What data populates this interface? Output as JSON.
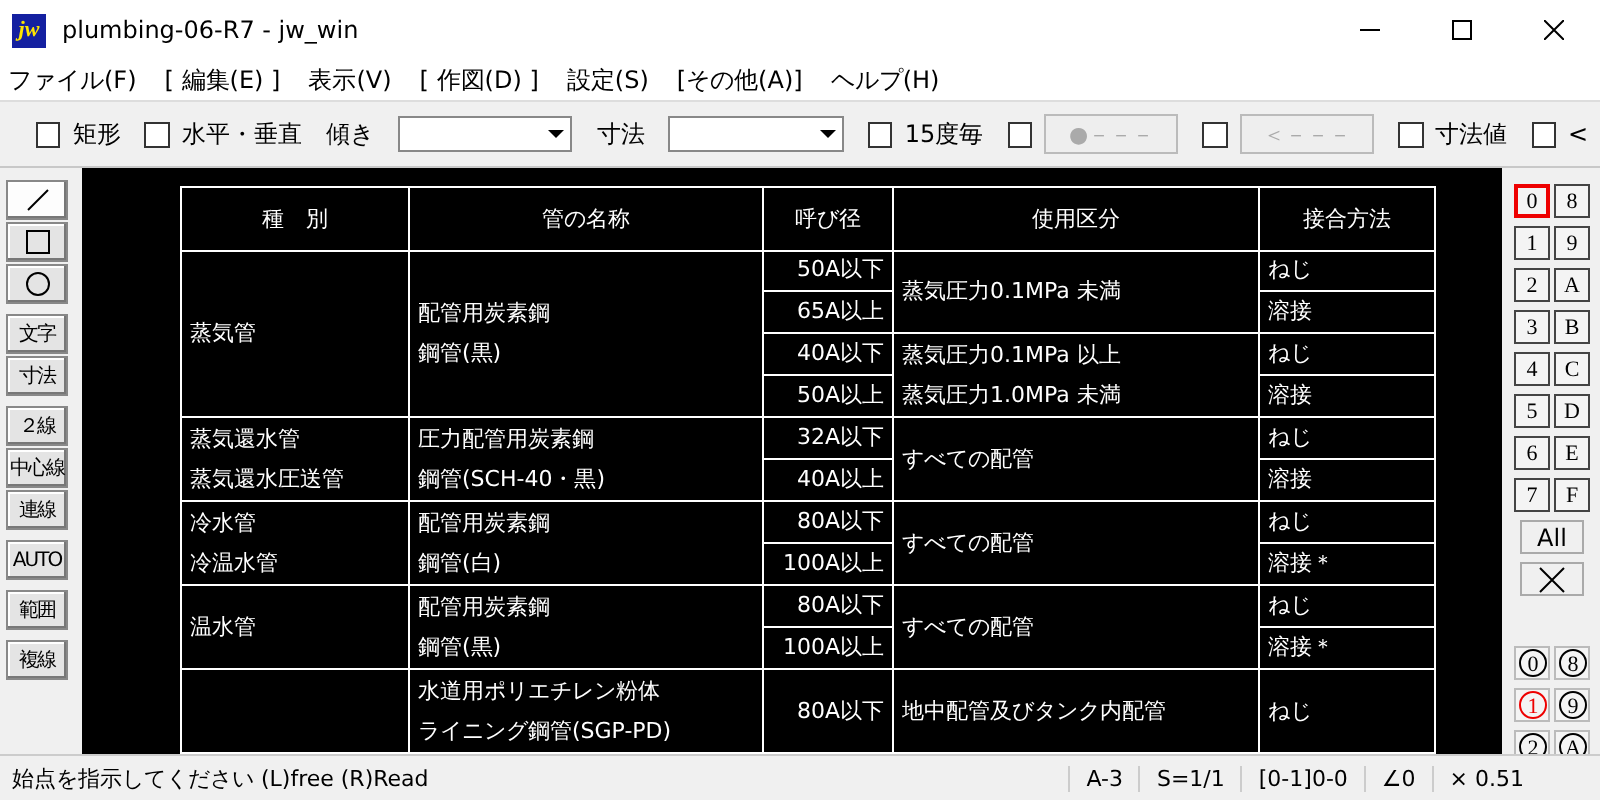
{
  "window": {
    "logo": "jw",
    "title": "plumbing-06-R7 - jw_win"
  },
  "menu": [
    "ファイル(F)",
    "[ 編集(E) ]",
    "表示(V)",
    "[ 作図(D) ]",
    "設定(S)",
    "[その他(A)]",
    "ヘルプ(H)"
  ],
  "toolbar": [
    {
      "kind": "check",
      "label": "矩形",
      "checked": false
    },
    {
      "kind": "check",
      "label": "水平・垂直",
      "checked": false
    },
    {
      "kind": "combo",
      "label": "傾き"
    },
    {
      "kind": "combo",
      "label": "寸法"
    },
    {
      "kind": "check",
      "label": "15度毎",
      "checked": false
    },
    {
      "kind": "checkbutton",
      "label": "●－－－",
      "checked": false,
      "disabled": true
    },
    {
      "kind": "checkbutton",
      "label": "＜－－－",
      "checked": false,
      "disabled": true
    },
    {
      "kind": "check",
      "label": "寸法値",
      "checked": false
    },
    {
      "kind": "check",
      "label": "<",
      "checked": false
    }
  ],
  "tools": [
    [
      {
        "kind": "line",
        "selected": true
      },
      {
        "kind": "rect",
        "selected": false
      },
      {
        "kind": "circle",
        "selected": false
      }
    ],
    [
      {
        "kind": "text",
        "label": "文字",
        "selected": false
      },
      {
        "kind": "text",
        "label": "寸法",
        "selected": false
      }
    ],
    [
      {
        "kind": "text",
        "label": "２線",
        "selected": false
      },
      {
        "kind": "text",
        "label": "中心線",
        "selected": false
      },
      {
        "kind": "text",
        "label": "連線",
        "selected": false
      }
    ],
    [
      {
        "kind": "text",
        "label": "AUTO",
        "selected": false
      }
    ],
    [
      {
        "kind": "text",
        "label": "範囲",
        "selected": false
      }
    ],
    [
      {
        "kind": "text",
        "label": "複線",
        "selected": false
      }
    ]
  ],
  "table": {
    "headers": [
      "種　別",
      "管の名称",
      "呼び径",
      "使用区分",
      "接合方法"
    ],
    "groups": [
      {
        "category": [
          "蒸気管"
        ],
        "pipe": [
          "配管用炭素鋼",
          "鋼管(黒)"
        ],
        "sizes": [
          "50A以下",
          "65A以上",
          "40A以下",
          "50A以上"
        ],
        "usage": [
          [
            "蒸気圧力0.1MPa 未満"
          ],
          [
            "蒸気圧力0.1MPa 以上",
            "蒸気圧力1.0MPa 未満"
          ]
        ],
        "joints": [
          "ねじ",
          "溶接",
          "ねじ",
          "溶接"
        ]
      },
      {
        "category": [
          "蒸気還水管",
          "蒸気還水圧送管"
        ],
        "pipe": [
          "圧力配管用炭素鋼",
          "鋼管(SCH-40・黒)"
        ],
        "sizes": [
          "32A以下",
          "40A以上"
        ],
        "usage": [
          [
            "すべての配管"
          ]
        ],
        "joints": [
          "ねじ",
          "溶接"
        ]
      },
      {
        "category": [
          "冷水管",
          "冷温水管"
        ],
        "pipe": [
          "配管用炭素鋼",
          "鋼管(白)"
        ],
        "sizes": [
          "80A以下",
          "100A以上"
        ],
        "usage": [
          [
            "すべての配管"
          ]
        ],
        "joints": [
          "ねじ",
          "溶接＊"
        ]
      },
      {
        "category": [
          "温水管"
        ],
        "pipe": [
          "配管用炭素鋼",
          "鋼管(黒)"
        ],
        "sizes": [
          "80A以下",
          "100A以上"
        ],
        "usage": [
          [
            "すべての配管"
          ]
        ],
        "joints": [
          "ねじ",
          "溶接＊"
        ]
      },
      {
        "pipe": [
          "水道用ポリエチレン粉体",
          "ライニング鋼管(SGP-PD)"
        ],
        "sizes": [
          "80A以下"
        ],
        "usage": [
          [
            "地中配管及びタンク内配管"
          ]
        ],
        "joints": [
          "ねじ"
        ]
      }
    ]
  },
  "layers": [
    {
      "label": "0",
      "selected": true
    },
    {
      "label": "8",
      "selected": false
    },
    {
      "label": "1",
      "selected": false
    },
    {
      "label": "9",
      "selected": false
    },
    {
      "label": "2",
      "selected": false
    },
    {
      "label": "A",
      "selected": false
    },
    {
      "label": "3",
      "selected": false
    },
    {
      "label": "B",
      "selected": false
    },
    {
      "label": "4",
      "selected": false
    },
    {
      "label": "C",
      "selected": false
    },
    {
      "label": "5",
      "selected": false
    },
    {
      "label": "D",
      "selected": false
    },
    {
      "label": "6",
      "selected": false
    },
    {
      "label": "E",
      "selected": false
    },
    {
      "label": "7",
      "selected": false
    },
    {
      "label": "F",
      "selected": false
    }
  ],
  "layer_all": "All",
  "layer_groups": [
    {
      "label": "0",
      "selected": false
    },
    {
      "label": "8",
      "selected": false
    },
    {
      "label": "1",
      "selected": true
    },
    {
      "label": "9",
      "selected": false
    },
    {
      "label": "2",
      "selected": false
    },
    {
      "label": "A",
      "selected": false
    }
  ],
  "status_bar": {
    "message": "始点を指示してください (L)free (R)Read",
    "fields": [
      "A-3",
      "S=1/1",
      "[0-1]0-0",
      "∠0",
      "× 0.51"
    ]
  }
}
